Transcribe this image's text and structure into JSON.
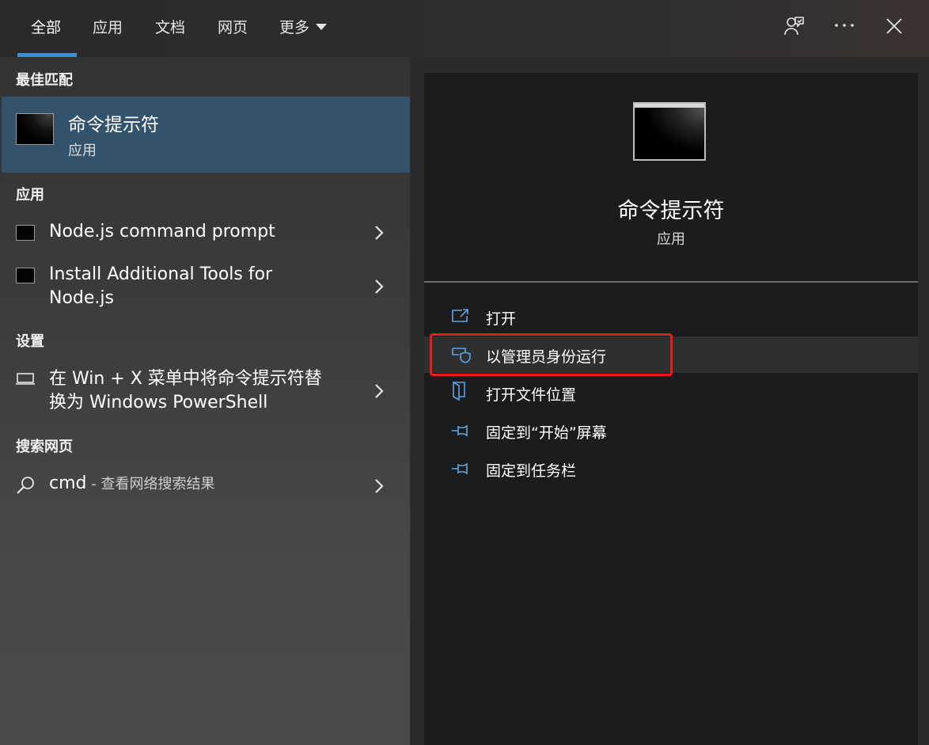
{
  "tabs": [
    {
      "label": "全部",
      "selected": true
    },
    {
      "label": "应用"
    },
    {
      "label": "文档"
    },
    {
      "label": "网页"
    },
    {
      "label": "更多"
    }
  ],
  "sections": {
    "best_match": "最佳匹配",
    "apps": "应用",
    "settings": "设置",
    "web": "搜索网页"
  },
  "best_match": {
    "title": "命令提示符",
    "subtitle": "应用"
  },
  "apps": [
    {
      "label": "Node.js command prompt"
    },
    {
      "line1": "Install Additional Tools for",
      "line2": "Node.js"
    }
  ],
  "settings": [
    {
      "line1": "在 Win + X 菜单中将命令提示符替",
      "line2": "换为 Windows PowerShell"
    }
  ],
  "web": {
    "query": "cmd",
    "hint": " - 查看网络搜索结果"
  },
  "preview": {
    "title": "命令提示符",
    "subtitle": "应用"
  },
  "actions": [
    {
      "label": "打开",
      "icon": "open-icon"
    },
    {
      "label": "以管理员身份运行",
      "icon": "shield-icon",
      "highlighted": true
    },
    {
      "label": "打开文件位置",
      "icon": "folder-icon"
    },
    {
      "label": "固定到“开始”屏幕",
      "icon": "pin-icon"
    },
    {
      "label": "固定到任务栏",
      "icon": "pin-icon"
    }
  ],
  "colors": {
    "accent": "#3a8fd6",
    "selection": "#32536b",
    "highlight_box": "#e81b1b",
    "action_icon": "#5aa6e6"
  }
}
